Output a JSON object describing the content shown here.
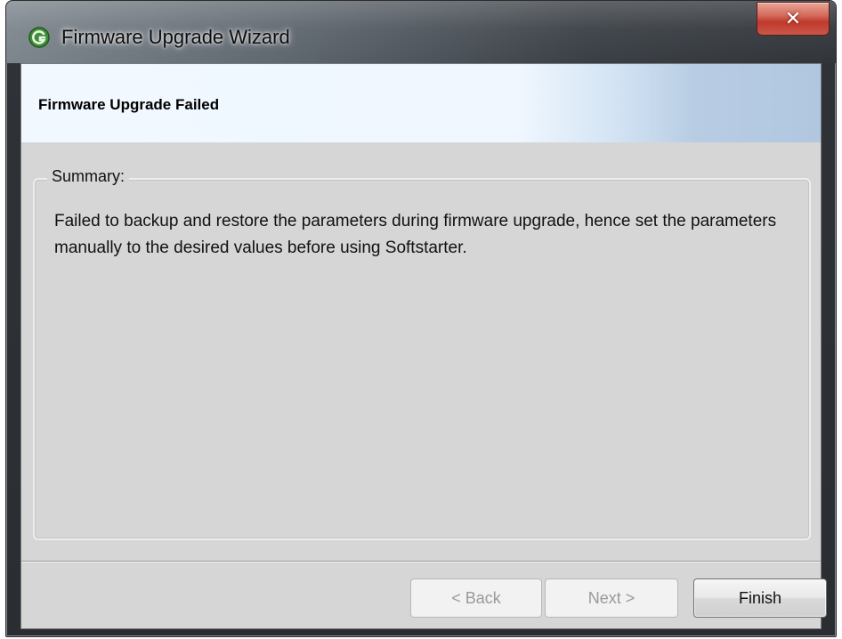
{
  "window": {
    "title": "Firmware Upgrade Wizard",
    "app_icon": "softstarter-app-icon",
    "close_glyph": "✕"
  },
  "header": {
    "title": "Firmware Upgrade Failed"
  },
  "summary": {
    "legend": "Summary:",
    "text": "Failed to backup and restore the parameters during firmware upgrade, hence set the parameters manually to the desired values before using Softstarter."
  },
  "buttons": {
    "back": {
      "label": "< Back",
      "enabled": false
    },
    "next": {
      "label": "Next >",
      "enabled": false
    },
    "finish": {
      "label": "Finish",
      "enabled": true
    }
  },
  "colors": {
    "dialog_background": "#d6d6d6",
    "header_band": "#f0f7ff",
    "close_button": "#c0392b"
  }
}
